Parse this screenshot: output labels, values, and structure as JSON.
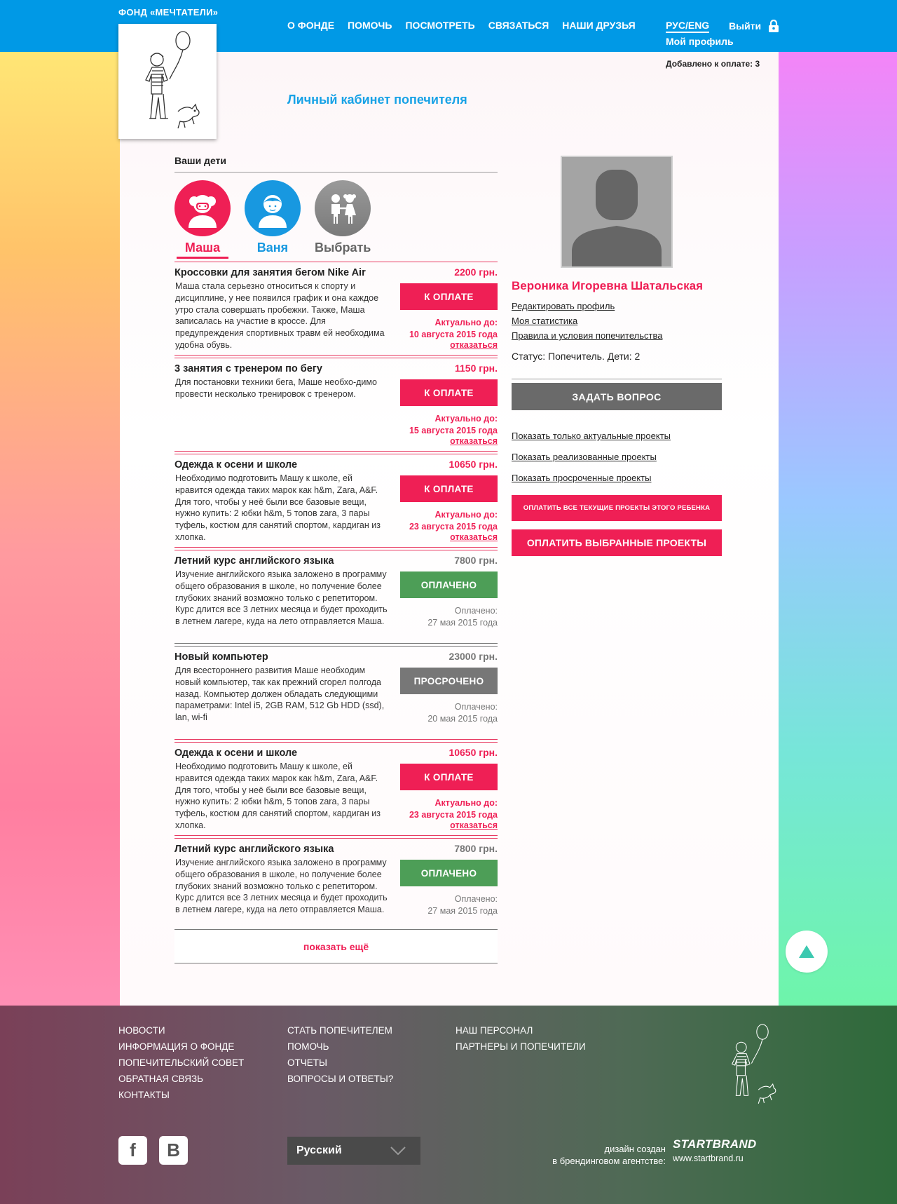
{
  "header": {
    "brand": "ФОНД «МЕЧТАТЕЛИ»",
    "nav": [
      "О ФОНДЕ",
      "ПОМОЧЬ",
      "ПОСМОТРЕТЬ",
      "СВЯЗАТЬСЯ",
      "НАШИ ДРУЗЬЯ"
    ],
    "lang": "РУС/ENG",
    "logout": "Выйти",
    "profile": "Мой профиль",
    "added_to_pay": "Добавлено к оплате: 3"
  },
  "page_title": "Личный кабинет попечителя",
  "children": {
    "heading": "Ваши дети",
    "items": [
      {
        "name": "Маша",
        "color": "#ef1f55"
      },
      {
        "name": "Ваня",
        "color": "#1898e0"
      },
      {
        "name": "Выбрать",
        "color": "#777777"
      }
    ]
  },
  "projects": [
    {
      "title": "Кроссовки для занятия бегом Nike Air",
      "price": "2200 грн.",
      "desc": "Маша стала серьезно относиться к спорту и дисциплине, у нее появился график и она каждое утро стала совершать пробежки. Также, Маша записалась на участие в кроссе. Для предупреждения спортивных травм ей необходима удобна обувь.",
      "button": "К ОПЛАТЕ",
      "date_label": "Актуально до:",
      "date": "10 августа 2015 года",
      "refuse": "отказаться"
    },
    {
      "title": "3 занятия с тренером по бегу",
      "price": "1150 грн.",
      "desc": "Для постановки техники бега, Маше необхо-димо провести несколько тренировок с тренером.",
      "button": "К ОПЛАТЕ",
      "date_label": "Актуально до:",
      "date": "15 августа 2015 года",
      "refuse": "отказаться"
    },
    {
      "title": "Одежда к осени и школе",
      "price": "10650 грн.",
      "desc": "Необходимо подготовить Машу к школе, ей нравится одежда таких марок как h&m, Zara, A&F. Для того, чтобы у неё были все базовые вещи, нужно купить: 2 юбки h&m, 5 топов zara, 3 пары туфель, костюм для санятий спортом, кардиган из хлопка.",
      "button": "К ОПЛАТЕ",
      "date_label": "Актуально до:",
      "date": "23 августа 2015 года",
      "refuse": "отказаться"
    },
    {
      "title": "Летний курс английского языка",
      "price": "7800 грн.",
      "desc": "Изучение английского языка заложено в программу общего образования в школе, но получение более глубоких знаний возможно только с репетитором. Курс длится все 3 летних месяца и будет проходить в летнем лагере, куда на лето отправляется Маша.",
      "button": "ОПЛАЧЕНО",
      "date_label": "Оплачено:",
      "date": "27 мая 2015 года"
    },
    {
      "title": "Новый компьютер",
      "price": "23000 грн.",
      "desc": "Для всестороннего развития Маше необходим новый компьютер, так как прежний сгорел полгода назад. Компьютер должен обладать следующими параметрами: Intel i5, 2GB RAM, 512 Gb HDD (ssd), lan, wi-fi",
      "button": "ПРОСРОЧЕНО",
      "date_label": "Оплачено:",
      "date": "20 мая 2015 года"
    },
    {
      "title": "Одежда к осени и школе",
      "price": "10650 грн.",
      "desc": "Необходимо подготовить Машу к школе, ей нравится одежда таких марок как h&m, Zara, A&F. Для того, чтобы у неё были все базовые вещи, нужно купить: 2 юбки h&m, 5 топов zara, 3 пары туфель, костюм для санятий спортом, кардиган из хлопка.",
      "button": "К ОПЛАТЕ",
      "date_label": "Актуально до:",
      "date": "23 августа 2015 года",
      "refuse": "отказаться"
    },
    {
      "title": "Летний курс английского языка",
      "price": "7800 грн.",
      "desc": "Изучение английского языка заложено в программу общего образования в школе, но получение более глубоких знаний возможно только с репетитором. Курс длится все 3 летних месяца и будет проходить в летнем лагере, куда на лето отправляется Маша.",
      "button": "ОПЛАЧЕНО",
      "date_label": "Оплачено:",
      "date": "27 мая 2015 года"
    }
  ],
  "show_more": "показать ещё",
  "sidebar": {
    "name": "Вероника Игоревна Шатальская",
    "links": [
      "Редактировать профиль",
      "Моя статистика",
      "Правила и условия попечительства"
    ],
    "status": "Статус: Попечитель. Дети: 2",
    "ask": "ЗАДАТЬ ВОПРОС",
    "filters": [
      "Показать только актуальные проекты",
      "Показать реализованные проекты",
      "Показать просроченные проекты"
    ],
    "pay_all": "ОПЛАТИТЬ ВСЕ ТЕКУЩИЕ ПРОЕКТЫ ЭТОГО РЕБЕНКА",
    "pay_selected": "ОПЛАТИТЬ ВЫБРАННЫЕ ПРОЕКТЫ"
  },
  "footer": {
    "col1": [
      "НОВОСТИ",
      "ИНФОРМАЦИЯ О ФОНДЕ",
      "ПОПЕЧИТЕЛЬСКИЙ СОВЕТ",
      "ОБРАТНАЯ СВЯЗЬ",
      "КОНТАКТЫ"
    ],
    "col2": [
      "СТАТЬ ПОПЕЧИТЕЛЕМ",
      "ПОМОЧЬ",
      "ОТЧЕТЫ",
      "ВОПРОСЫ И ОТВЕТЫ?"
    ],
    "col3": [
      "НАШ ПЕРСОНАЛ",
      "ПАРТНЕРЫ И ПОПЕЧИТЕЛИ"
    ],
    "language": "Русский",
    "credit_line1": "дизайн создан",
    "credit_line2": "в брендинговом агентстве:",
    "agency": "STARTBRAND",
    "agency_url": "www.startbrand.ru"
  }
}
